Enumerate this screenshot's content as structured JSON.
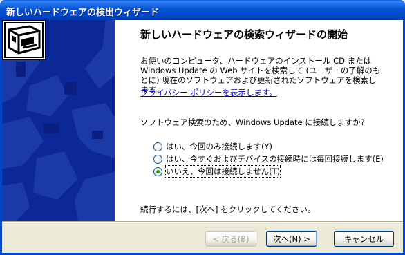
{
  "window": {
    "title": "新しいハードウェアの検出ウィザード"
  },
  "heading": "新しいハードウェアの検索ウィザードの開始",
  "description": "お使いのコンピュータ、ハードウェアのインストール CD または Windows Update の Web サイトを検索して (ユーザーの了解のもとに) 現在のソフトウェアおよび更新されたソフトウェアを検索します。",
  "privacy_link": "プライバシー ポリシーを表示します。",
  "question": "ソフトウェア検索のため、Windows Update に接続しますか?",
  "options": [
    {
      "label": "はい、今回のみ接続します(Y)",
      "checked": false
    },
    {
      "label": "はい、今すぐおよびデバイスの接続時には毎回接続します(E)",
      "checked": false
    },
    {
      "label": "いいえ、今回は接続しません(T)",
      "checked": true
    }
  ],
  "continue_text": "続行するには、[次へ] をクリックしてください。",
  "buttons": {
    "back": "< 戻る(B)",
    "next": "次へ(N) >",
    "cancel": "キャンセル"
  },
  "colors": {
    "titlebar": "#0054e3",
    "side_panel": "#0c2797",
    "dialog_bg": "#ece9d8",
    "link": "#0000cc"
  },
  "icons": {
    "wizard": "hardware-wizard-icon"
  }
}
